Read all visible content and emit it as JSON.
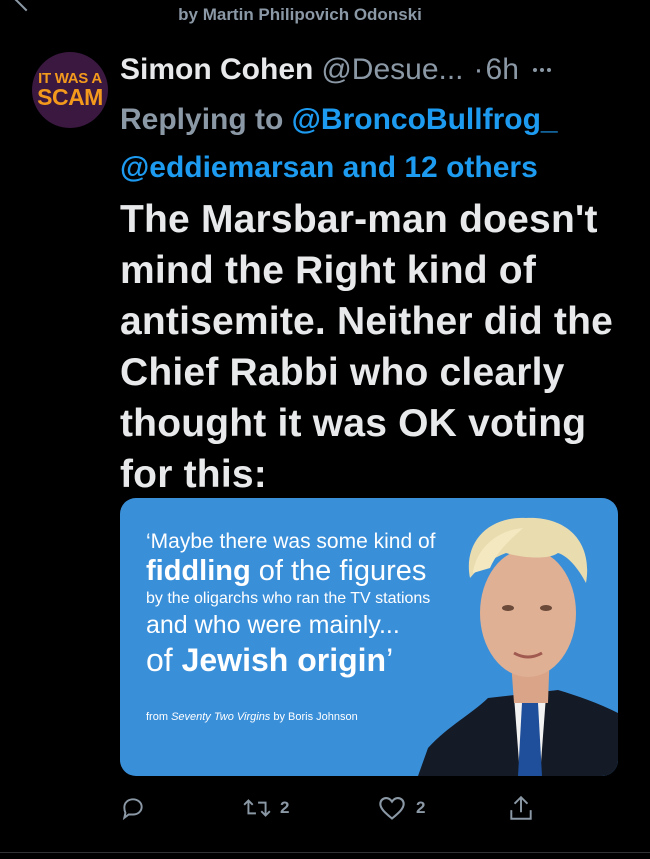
{
  "top_bar": {
    "by_line": "by Martin Philipovich Odonski"
  },
  "tweet": {
    "avatar": {
      "line1": "IT WAS A",
      "line2": "SCAM"
    },
    "author_name": "Simon Cohen",
    "author_handle": "@Desue...",
    "dot": "·",
    "time": "6h",
    "reply": {
      "prefix": "Replying to ",
      "mention1": "@BroncoBullfrog_",
      "mention2": "@eddiemarsan",
      "and_word": " and ",
      "others": "12 others"
    },
    "text": "The Marsbar-man doesn't mind the Right kind of antisemite. Neither did the Chief Rabbi who clearly thought it was OK voting for this:",
    "media": {
      "line1": "‘Maybe there was some kind of",
      "line2_bold": "fiddling",
      "line2_rest": " of the figures",
      "line3": "by the oligarchs who ran the TV stations",
      "line4": "and who were mainly...",
      "line5_pre": "of ",
      "line5_bold": "Jewish origin",
      "line5_post": "’",
      "credit_pre": "from ",
      "credit_title": "Seventy Two Virgins",
      "credit_post": " by Boris Johnson"
    },
    "actions": {
      "reply_icon": "reply-icon",
      "retweet_icon": "retweet-icon",
      "retweet_count": "2",
      "like_icon": "heart-icon",
      "like_count": "2",
      "share_icon": "share-icon"
    }
  },
  "colors": {
    "background": "#000000",
    "text": "#e7e9ea",
    "muted": "#8b98a5",
    "link": "#1d9bf0",
    "media_bg": "#3a8fd9",
    "avatar_bg": "#3a1840",
    "avatar_text": "#f39a1d"
  }
}
